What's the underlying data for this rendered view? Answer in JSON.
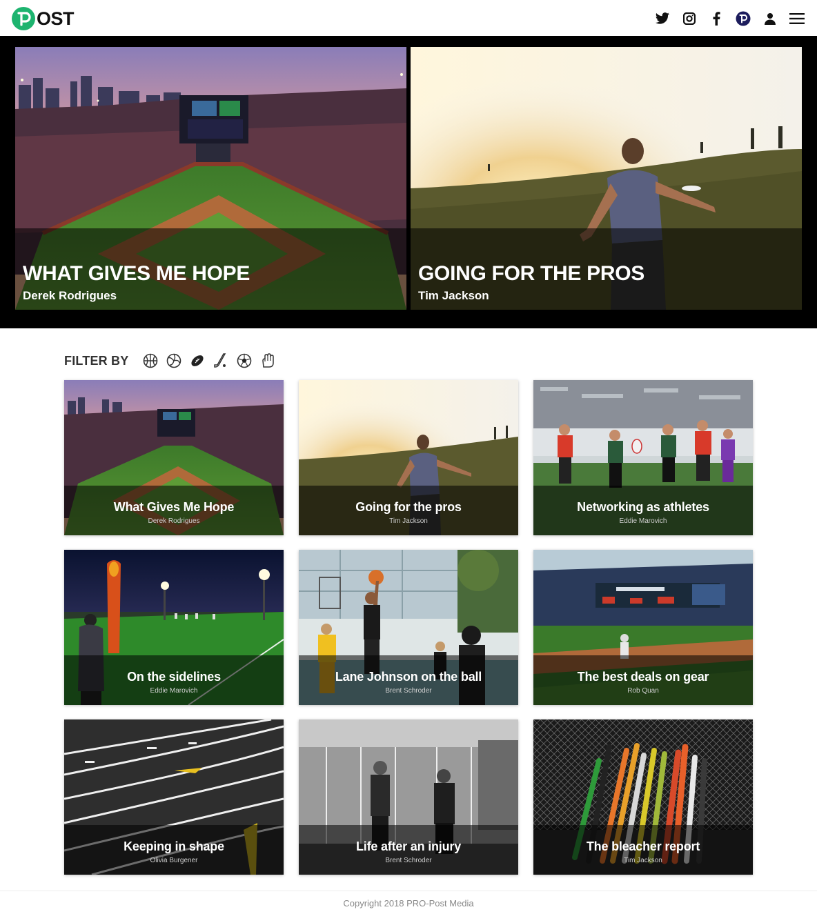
{
  "header": {
    "logo_text": "OST",
    "icons": [
      "twitter-icon",
      "instagram-icon",
      "facebook-icon",
      "pro-post-icon",
      "user-icon",
      "menu-icon"
    ]
  },
  "hero": [
    {
      "title": "WHAT GIVES ME HOPE",
      "author": "Derek Rodrigues"
    },
    {
      "title": "GOING FOR THE PROS",
      "author": "Tim Jackson"
    }
  ],
  "filter": {
    "label": "FILTER BY",
    "icons": [
      "basketball-icon",
      "volleyball-icon",
      "football-icon",
      "hockey-stick-icon",
      "soccer-ball-icon",
      "hand-icon"
    ]
  },
  "articles": [
    {
      "title": "What Gives Me Hope",
      "author": "Derek Rodrigues"
    },
    {
      "title": "Going for the pros",
      "author": "Tim Jackson"
    },
    {
      "title": "Networking as athletes",
      "author": "Eddie Marovich"
    },
    {
      "title": "On the sidelines",
      "author": "Eddie Marovich"
    },
    {
      "title": "Lane Johnson on the ball",
      "author": "Brent Schroder"
    },
    {
      "title": "The best deals on gear",
      "author": "Rob Quan"
    },
    {
      "title": "Keeping in shape",
      "author": "Olivia Burgener"
    },
    {
      "title": "Life after an injury",
      "author": "Brent Schroder"
    },
    {
      "title": "The bleacher report",
      "author": "Tim Jackson"
    }
  ],
  "footer": {
    "copyright": "Copyright 2018 PRO-Post Media"
  },
  "colors": {
    "brand": "#1db46f",
    "hero_bg": "#000000"
  }
}
